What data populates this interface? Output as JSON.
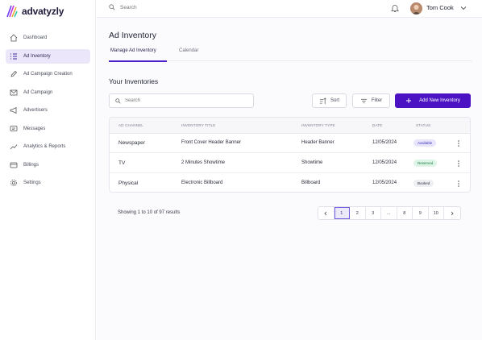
{
  "app": {
    "name": "advatyzly",
    "brand_color": "#4b12c4"
  },
  "sidebar": {
    "items": [
      {
        "label": "Dashboard",
        "icon": "home-icon",
        "active": false
      },
      {
        "label": "Ad Inventory",
        "icon": "list-icon",
        "active": true
      },
      {
        "label": "Ad Campaign Creation",
        "icon": "pencil-icon",
        "active": false
      },
      {
        "label": "Ad Campaign",
        "icon": "mail-icon",
        "active": false
      },
      {
        "label": "Advertisers",
        "icon": "megaphone-icon",
        "active": false
      },
      {
        "label": "Messages",
        "icon": "message-icon",
        "active": false
      },
      {
        "label": "Analytics & Reports",
        "icon": "chart-icon",
        "active": false
      },
      {
        "label": "Billings",
        "icon": "card-icon",
        "active": false
      },
      {
        "label": "Settings",
        "icon": "gear-icon",
        "active": false
      }
    ]
  },
  "topbar": {
    "search_placeholder": "Search",
    "user_name": "Tom Cook"
  },
  "page": {
    "title": "Ad Inventory",
    "tabs": [
      "Manage Ad Inventory",
      "Calendar"
    ],
    "active_tab": 0,
    "section_title": "Your Inventories"
  },
  "toolbar": {
    "search_placeholder": "Search",
    "sort_label": "Sort",
    "filter_label": "Filter",
    "add_label": "Add New Inventory"
  },
  "table": {
    "headers": [
      "AD CHANNEL",
      "INVENTORY TITLE",
      "INVENTORY TYPE",
      "DATE",
      "STATUS"
    ],
    "rows": [
      {
        "channel": "Newspaper",
        "title": "Front Cover Header Banner",
        "type": "Header Banner",
        "date": "12/05/2024",
        "status": "Available",
        "status_bg": "#e7e5fb",
        "status_fg": "#4036b8"
      },
      {
        "channel": "TV",
        "title": "2 Minutes Showtime",
        "type": "Showtime",
        "date": "12/05/2024",
        "status": "Reserved",
        "status_bg": "#ddf5e6",
        "status_fg": "#1e7a45"
      },
      {
        "channel": "Physical",
        "title": "Electronic Billboard",
        "type": "Billboard",
        "date": "12/05/2024",
        "status": "Booked",
        "status_bg": "#eeeff3",
        "status_fg": "#2b2e3d"
      }
    ]
  },
  "pagination": {
    "summary": "Showing 1 to 10 of 97 results",
    "pages": [
      "1",
      "2",
      "3",
      "...",
      "8",
      "9",
      "10"
    ],
    "current": "1"
  }
}
